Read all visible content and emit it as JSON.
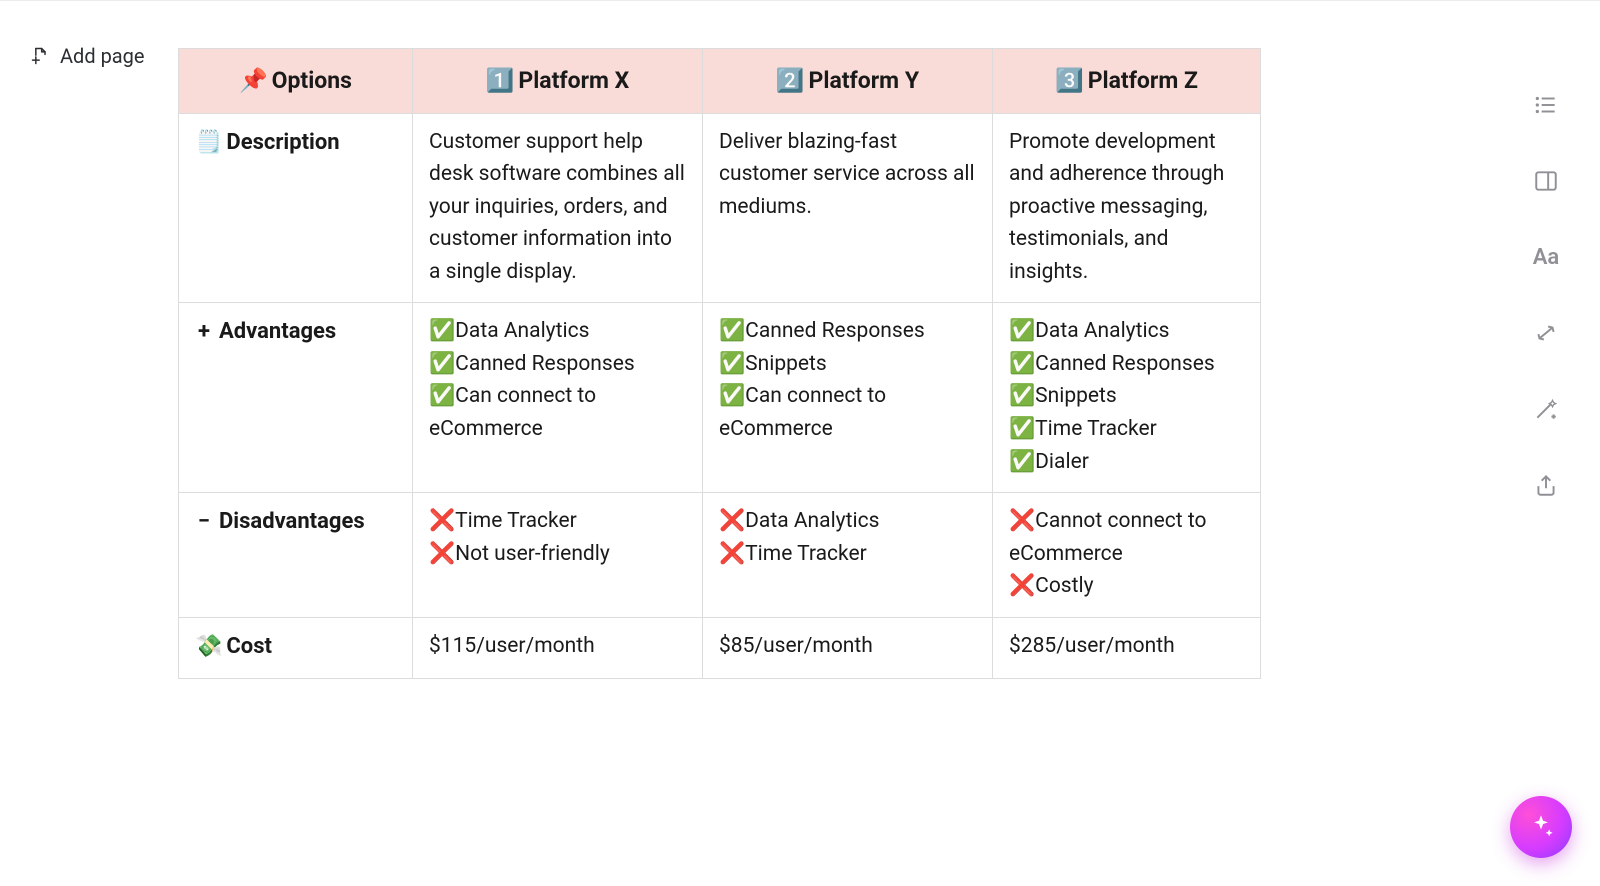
{
  "add_page_label": "Add page",
  "table": {
    "headers": {
      "options": {
        "emoji": "📌",
        "label": "Options"
      },
      "col1": {
        "emoji": "1️⃣",
        "label": "Platform X"
      },
      "col2": {
        "emoji": "2️⃣",
        "label": "Platform Y"
      },
      "col3": {
        "emoji": "3️⃣",
        "label": "Platform Z"
      }
    },
    "rows": {
      "description": {
        "label_emoji": "🗒️",
        "label": "Description",
        "platform_x": "Customer support help desk software combines all your inquiries, orders, and customer information into a single display.",
        "platform_y": "Deliver blazing-fast customer service across all mediums.",
        "platform_z": "Promote development and adherence through proactive messaging, testimonials, and insights."
      },
      "advantages": {
        "label_prefix": "+",
        "label": "Advantages",
        "platform_x": [
          "✅Data Analytics",
          "✅Canned Responses",
          "✅Can connect to eCommerce"
        ],
        "platform_y": [
          "✅Canned Responses",
          "✅Snippets",
          "✅Can connect to eCommerce"
        ],
        "platform_z": [
          "✅Data Analytics",
          "✅Canned Responses",
          "✅Snippets",
          "✅Time Tracker",
          "✅Dialer"
        ]
      },
      "disadvantages": {
        "label_prefix": "−",
        "label": "Disadvantages",
        "platform_x": [
          "❌Time Tracker",
          "❌Not user-friendly"
        ],
        "platform_y": [
          "❌Data Analytics",
          "❌Time Tracker"
        ],
        "platform_z": [
          "❌Cannot connect to eCommerce",
          "❌Costly"
        ]
      },
      "cost": {
        "label_emoji": "💸",
        "label": "Cost",
        "platform_x": "$115/user/month",
        "platform_y": "$85/user/month",
        "platform_z": "$285/user/month"
      }
    }
  },
  "side_toolbar": {
    "outline": "outline",
    "layout": "layout",
    "typography": "Aa",
    "swap": "swap",
    "magic": "magic",
    "share": "share"
  },
  "ai_fab": "ai-assistant"
}
